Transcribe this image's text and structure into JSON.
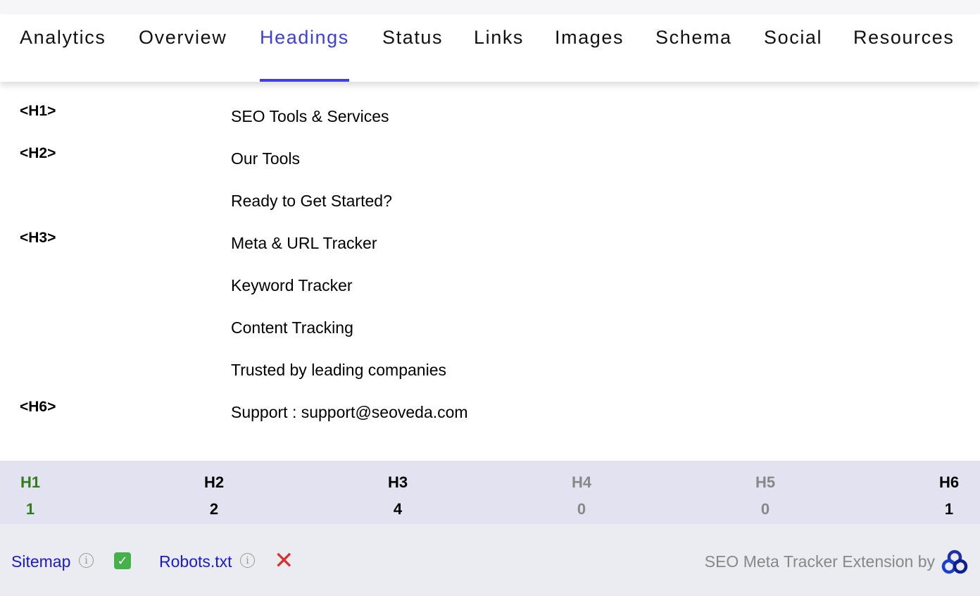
{
  "tabs": [
    {
      "label": "Analytics"
    },
    {
      "label": "Overview"
    },
    {
      "label": "Headings",
      "active": true
    },
    {
      "label": "Status"
    },
    {
      "label": "Links"
    },
    {
      "label": "Images"
    },
    {
      "label": "Schema"
    },
    {
      "label": "Social"
    },
    {
      "label": "Resources"
    }
  ],
  "headings": [
    {
      "tag": "<H1>",
      "text": "SEO Tools & Services"
    },
    {
      "tag": "<H2>",
      "text": "Our Tools"
    },
    {
      "tag": "",
      "text": "Ready to Get Started?"
    },
    {
      "tag": "<H3>",
      "text": "Meta & URL Tracker"
    },
    {
      "tag": "",
      "text": "Keyword Tracker"
    },
    {
      "tag": "",
      "text": "Content Tracking"
    },
    {
      "tag": "",
      "text": "Trusted by leading companies"
    },
    {
      "tag": "<H6>",
      "text": "Support : support@seoveda.com"
    }
  ],
  "counts": [
    {
      "label": "H1",
      "value": "1",
      "color": "#2e7d1a"
    },
    {
      "label": "H2",
      "value": "2",
      "color": "#000000"
    },
    {
      "label": "H3",
      "value": "4",
      "color": "#000000"
    },
    {
      "label": "H4",
      "value": "0",
      "color": "#888888"
    },
    {
      "label": "H5",
      "value": "0",
      "color": "#888888"
    },
    {
      "label": "H6",
      "value": "1",
      "color": "#000000"
    }
  ],
  "footer": {
    "sitemap_label": "Sitemap",
    "sitemap_icon": "check-icon",
    "robots_label": "Robots.txt",
    "robots_icon": "cross-icon",
    "credit": "SEO Meta Tracker Extension by"
  },
  "colors": {
    "accent": "#4040d8",
    "link": "#1a1ad4",
    "ok": "#44b14a",
    "error": "#d8322c"
  }
}
